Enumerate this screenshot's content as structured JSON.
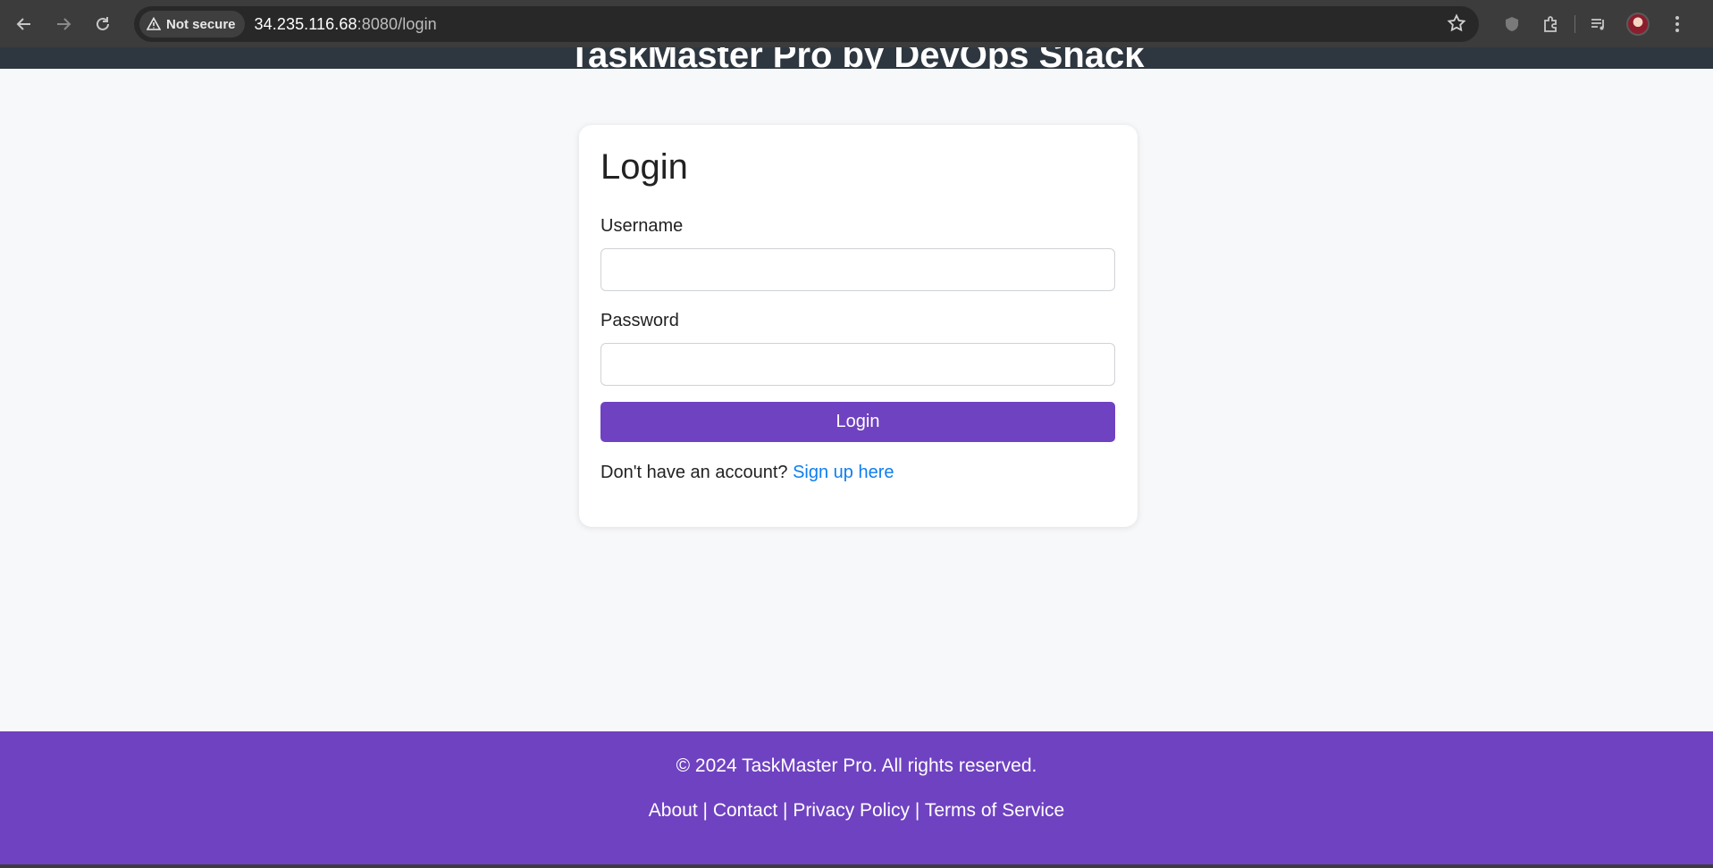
{
  "browser": {
    "security_label": "Not secure",
    "url_host": "34.235.116.68",
    "url_rest": ":8080/login",
    "icons": [
      "back-icon",
      "forward-icon",
      "reload-icon",
      "warning-icon",
      "star-icon",
      "shield-icon",
      "extensions-icon",
      "media-icon",
      "avatar",
      "menu-icon"
    ]
  },
  "header": {
    "title": "TaskMaster Pro by DevOps Shack"
  },
  "login": {
    "heading": "Login",
    "username_label": "Username",
    "username_value": "",
    "password_label": "Password",
    "password_value": "",
    "submit_label": "Login",
    "signup_prompt": "Don't have an account?",
    "signup_link": "Sign up here"
  },
  "footer": {
    "copyright": "© 2024 TaskMaster Pro. All rights reserved.",
    "links": [
      "About",
      "Contact",
      "Privacy Policy",
      "Terms of Service"
    ],
    "separator": "|"
  },
  "colors": {
    "accent": "#6f42c1",
    "link": "#0d7ef0",
    "header_bg": "#2e3740",
    "page_bg": "#f7f8fa"
  }
}
